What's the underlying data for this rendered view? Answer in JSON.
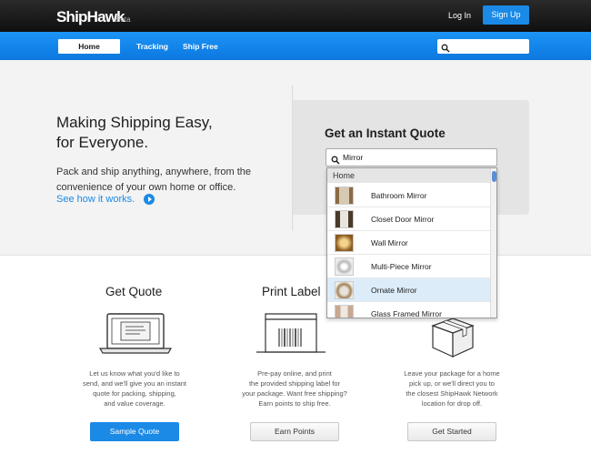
{
  "header": {
    "brand": "ShipHawk",
    "beta": "Beta",
    "login": "Log In",
    "signup": "Sign Up"
  },
  "nav": {
    "home": "Home",
    "tracking": "Tracking",
    "ship_free": "Ship Free",
    "search_value": ""
  },
  "hero": {
    "title_line1": "Making Shipping Easy,",
    "title_line2": "for Everyone.",
    "sub_line1": "Pack and ship anything, anywhere, from the",
    "sub_line2": "convenience of your own home or office.",
    "link": "See how it works."
  },
  "quote": {
    "title": "Get an Instant Quote",
    "input_value": "Mirror"
  },
  "dropdown": {
    "header": "Home",
    "items": [
      {
        "label": "Bathroom Mirror",
        "selected": false
      },
      {
        "label": "Closet Door Mirror",
        "selected": false
      },
      {
        "label": "Wall Mirror",
        "selected": false
      },
      {
        "label": "Multi-Piece Mirror",
        "selected": false
      },
      {
        "label": "Ornate Mirror",
        "selected": true
      },
      {
        "label": "Glass Framed Mirror",
        "selected": false
      }
    ]
  },
  "features": [
    {
      "title": "Get Quote",
      "text": [
        "Let us know what you'd like to",
        "send, and we'll give you an instant",
        "quote for packing, shipping,",
        "and value coverage."
      ],
      "button": "Sample Quote"
    },
    {
      "title": "Print Label",
      "text": [
        "Pre-pay online, and print",
        "the provided shipping label for",
        "your package. Want free shipping?",
        "Earn points to ship free."
      ],
      "button": "Earn Points"
    },
    {
      "title": "",
      "text": [
        "Leave your package for a home",
        "pick up, or we'll direct you to",
        "the closest ShipHawk Network",
        "location for drop off."
      ],
      "button": "Get Started"
    }
  ],
  "colors": {
    "accent": "#1a8ae6",
    "topbar": "#1a1a1a",
    "selected_row": "#dcecf9"
  }
}
